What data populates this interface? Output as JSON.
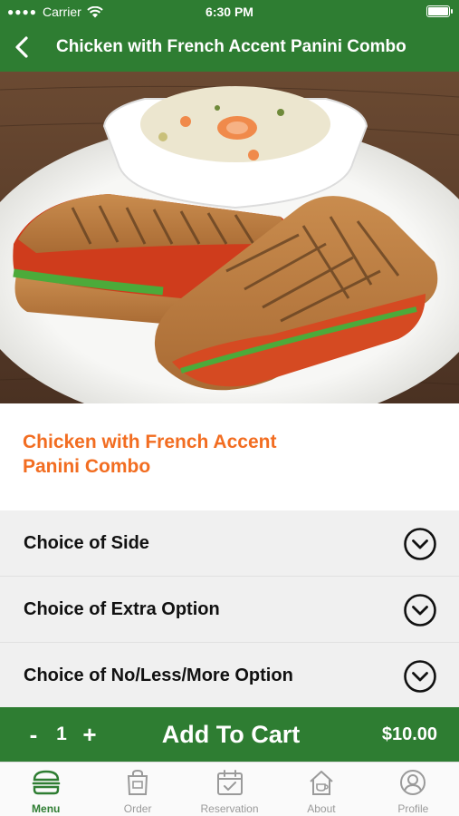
{
  "status_bar": {
    "carrier": "Carrier",
    "time": "6:30 PM"
  },
  "nav": {
    "title": "Chicken with French Accent Panini Combo"
  },
  "product": {
    "title": "Chicken with French Accent Panini Combo"
  },
  "options": [
    {
      "label": "Choice of Side"
    },
    {
      "label": "Choice of Extra Option"
    },
    {
      "label": "Choice of No/Less/More Option"
    }
  ],
  "cart": {
    "minus": "-",
    "quantity": "1",
    "plus": "+",
    "add_label": "Add To Cart",
    "price": "$10.00"
  },
  "tabs": [
    {
      "label": "Menu",
      "icon": "burger-icon",
      "active": true
    },
    {
      "label": "Order",
      "icon": "bag-icon",
      "active": false
    },
    {
      "label": "Reservation",
      "icon": "calendar-check-icon",
      "active": false
    },
    {
      "label": "About",
      "icon": "coffee-house-icon",
      "active": false
    },
    {
      "label": "Profile",
      "icon": "user-icon",
      "active": false
    }
  ],
  "colors": {
    "brand_green": "#2e7d32",
    "accent_orange": "#f26d21",
    "option_bg": "#f0f0f0",
    "tab_inactive": "#9a9a9a"
  }
}
